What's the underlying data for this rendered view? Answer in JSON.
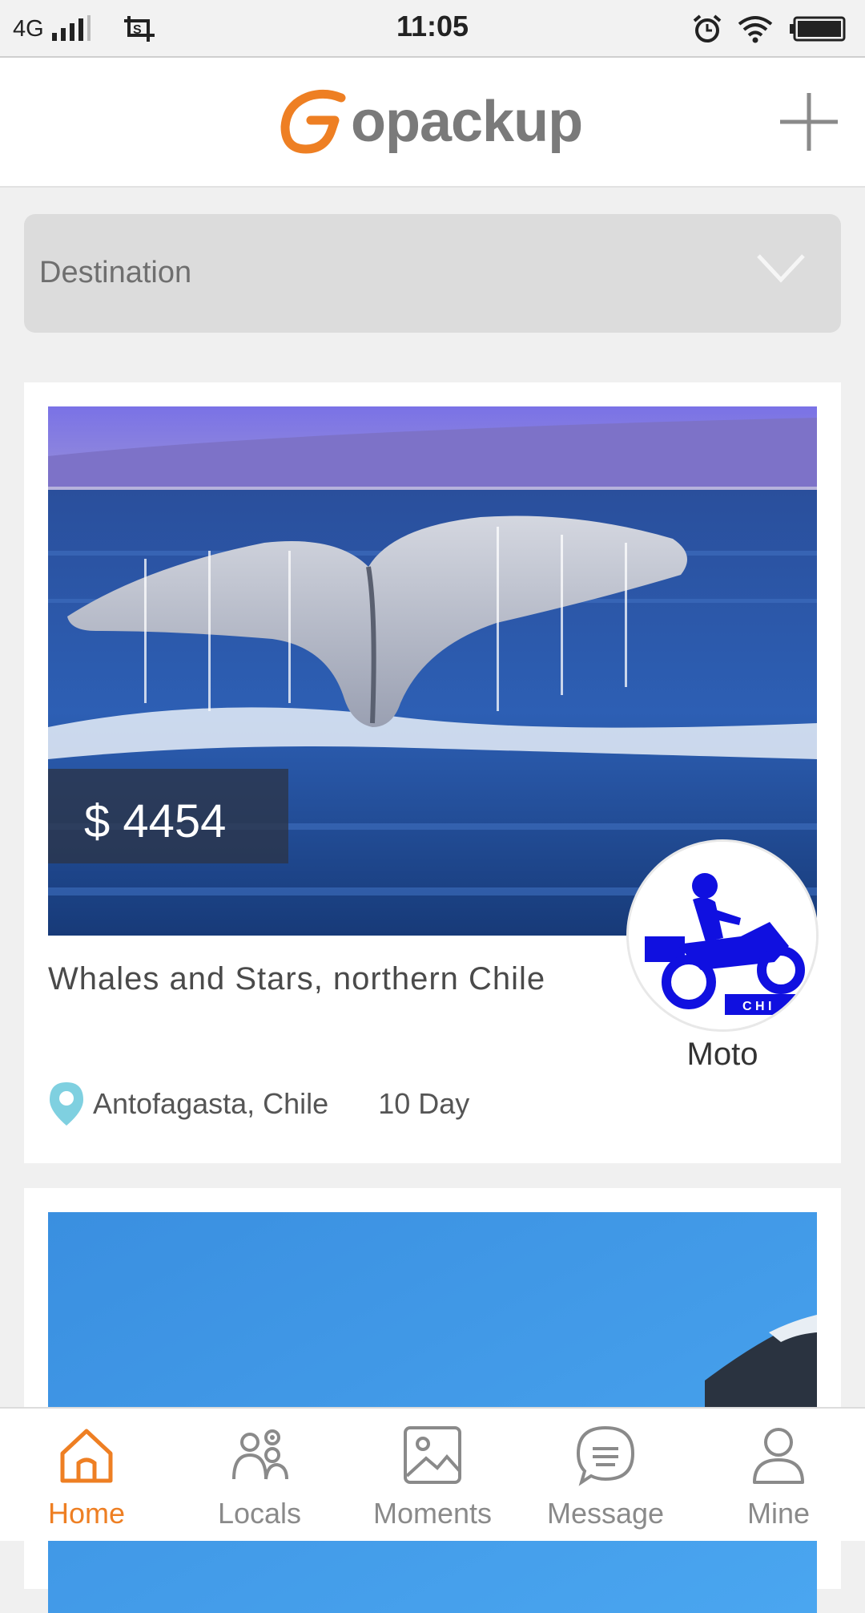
{
  "status_bar": {
    "network": "4G",
    "time": "11:05"
  },
  "header": {
    "brand_rest": "opackup",
    "brand_color": "#ee7f23",
    "add_icon": "plus-icon"
  },
  "filter": {
    "destination_placeholder": "Destination"
  },
  "trips": [
    {
      "price": "$ 4454",
      "title": "Whales and Stars, northern Chile",
      "location": "Antofagasta, Chile",
      "duration": "10 Day",
      "guide_name": "Moto"
    }
  ],
  "bottom_nav": {
    "active_color": "#ee7f23",
    "items": [
      {
        "label": "Home",
        "icon": "home-icon"
      },
      {
        "label": "Locals",
        "icon": "people-icon"
      },
      {
        "label": "Moments",
        "icon": "image-icon"
      },
      {
        "label": "Message",
        "icon": "chat-icon"
      },
      {
        "label": "Mine",
        "icon": "user-icon"
      }
    ]
  }
}
